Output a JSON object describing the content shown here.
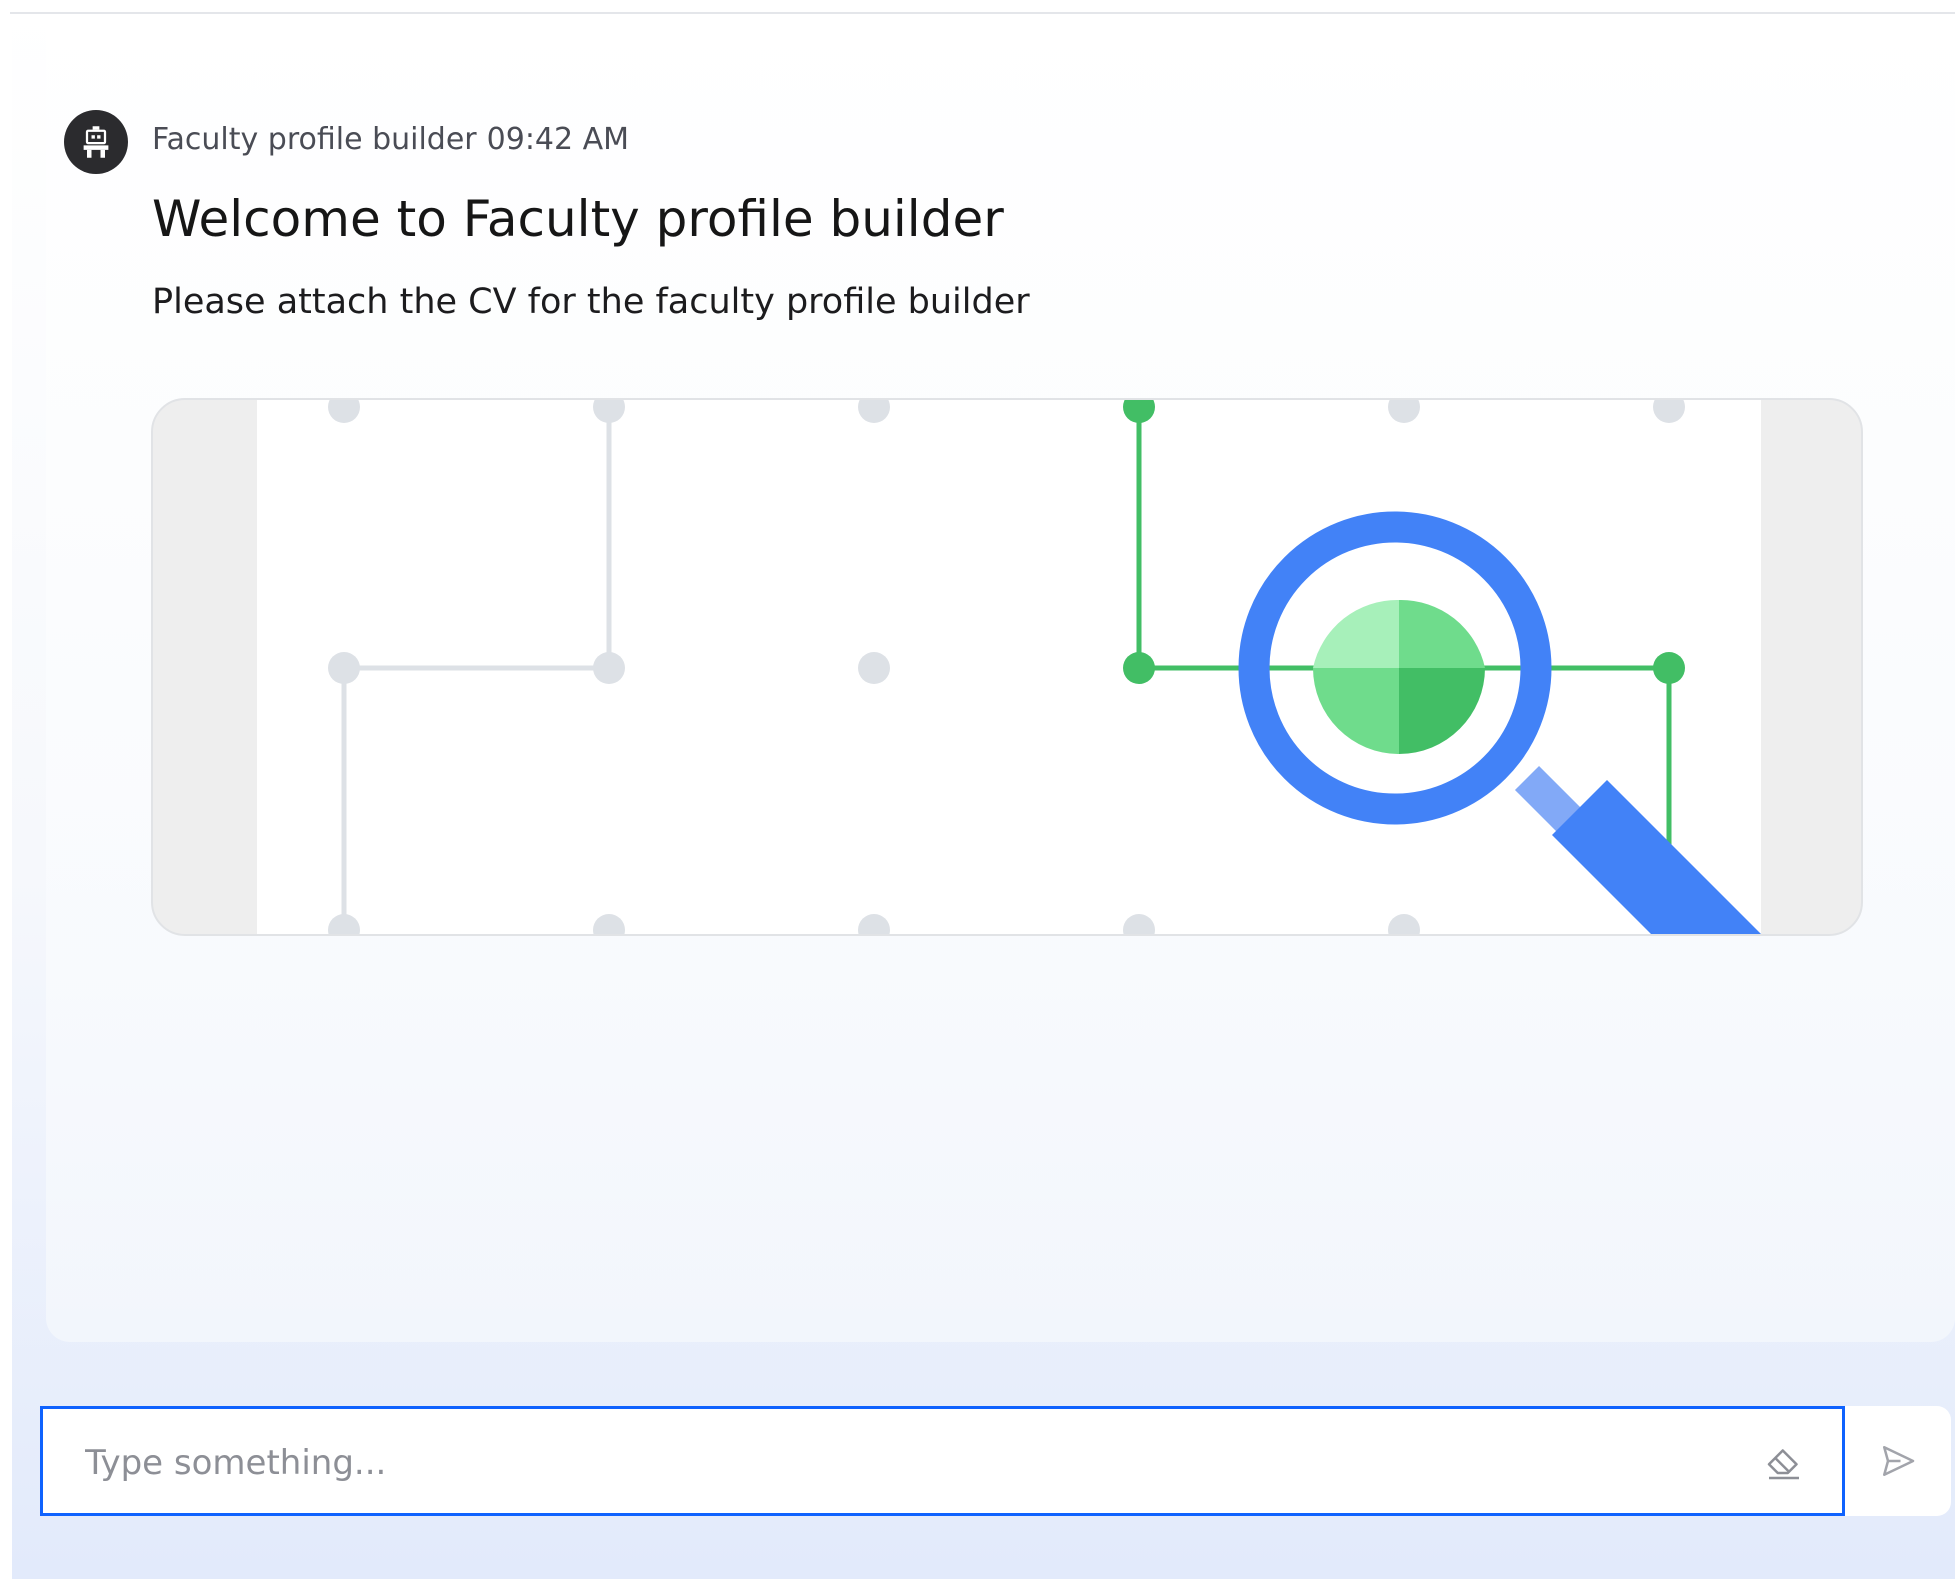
{
  "message": {
    "sender": "Faculty profile builder",
    "time": "09:42 AM",
    "avatar_icon": "robot-icon",
    "title": "Welcome to Faculty profile builder",
    "text": "Please attach the CV for the faculty profile builder"
  },
  "image": {
    "icon": "magnifier-network-illustration",
    "colors": {
      "grid": "#dde1e6",
      "green": "#42be65",
      "blue": "#4282f7"
    }
  },
  "input": {
    "placeholder": "Type something...",
    "value": "",
    "clear_icon": "eraser-icon",
    "send_icon": "send-icon"
  },
  "colors": {
    "accent": "#0f62fe",
    "avatar_bg": "#2b2b2e"
  }
}
